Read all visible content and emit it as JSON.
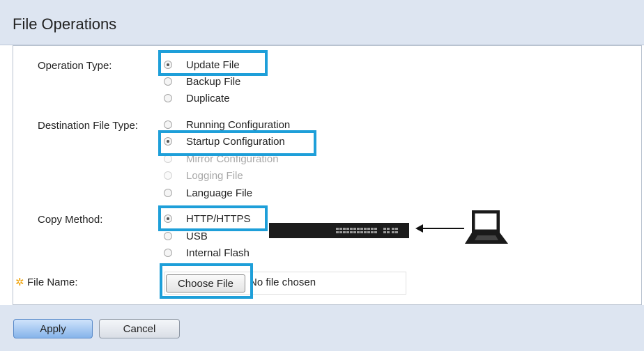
{
  "page": {
    "title": "File Operations"
  },
  "form": {
    "operation_type": {
      "label": "Operation Type:",
      "options": [
        {
          "label": "Update File",
          "selected": true
        },
        {
          "label": "Backup File",
          "selected": false
        },
        {
          "label": "Duplicate",
          "selected": false
        }
      ]
    },
    "destination_file_type": {
      "label": "Destination File Type:",
      "options": [
        {
          "label": "Running Configuration",
          "selected": false,
          "disabled": false
        },
        {
          "label": "Startup Configuration",
          "selected": true,
          "disabled": false
        },
        {
          "label": "Mirror Configuration",
          "selected": false,
          "disabled": true
        },
        {
          "label": "Logging File",
          "selected": false,
          "disabled": true
        },
        {
          "label": "Language File",
          "selected": false,
          "disabled": false
        }
      ]
    },
    "copy_method": {
      "label": "Copy Method:",
      "options": [
        {
          "label": "HTTP/HTTPS",
          "selected": true
        },
        {
          "label": "USB",
          "selected": false
        },
        {
          "label": "Internal Flash",
          "selected": false
        }
      ]
    },
    "file_name": {
      "required_marker": "✲",
      "label": "File Name:",
      "choose_button": "Choose File",
      "status": "No file chosen"
    }
  },
  "actions": {
    "apply": "Apply",
    "cancel": "Cancel"
  },
  "colors": {
    "highlight": "#1e9fd9",
    "header_bg": "#dde5f1",
    "required": "#f0a30a"
  }
}
